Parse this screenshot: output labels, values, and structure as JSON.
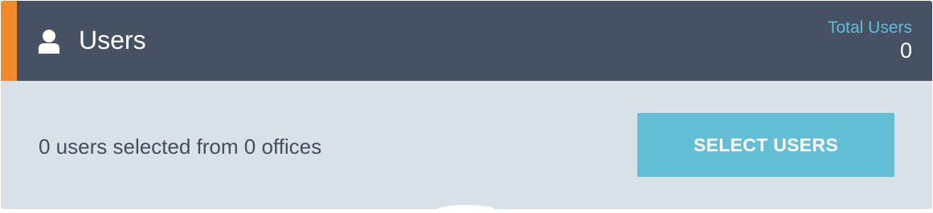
{
  "header": {
    "icon": "user-icon",
    "title": "Users",
    "stat_label": "Total Users",
    "stat_value": "0"
  },
  "body": {
    "summary": "0 users selected from 0 offices",
    "select_button_label": "SELECT USERS"
  },
  "colors": {
    "header_background": "#475164",
    "accent": "#f4892a",
    "panel_background": "#d9e1e8",
    "button": "#62bfd6",
    "stat_label": "#5bbfd6"
  }
}
